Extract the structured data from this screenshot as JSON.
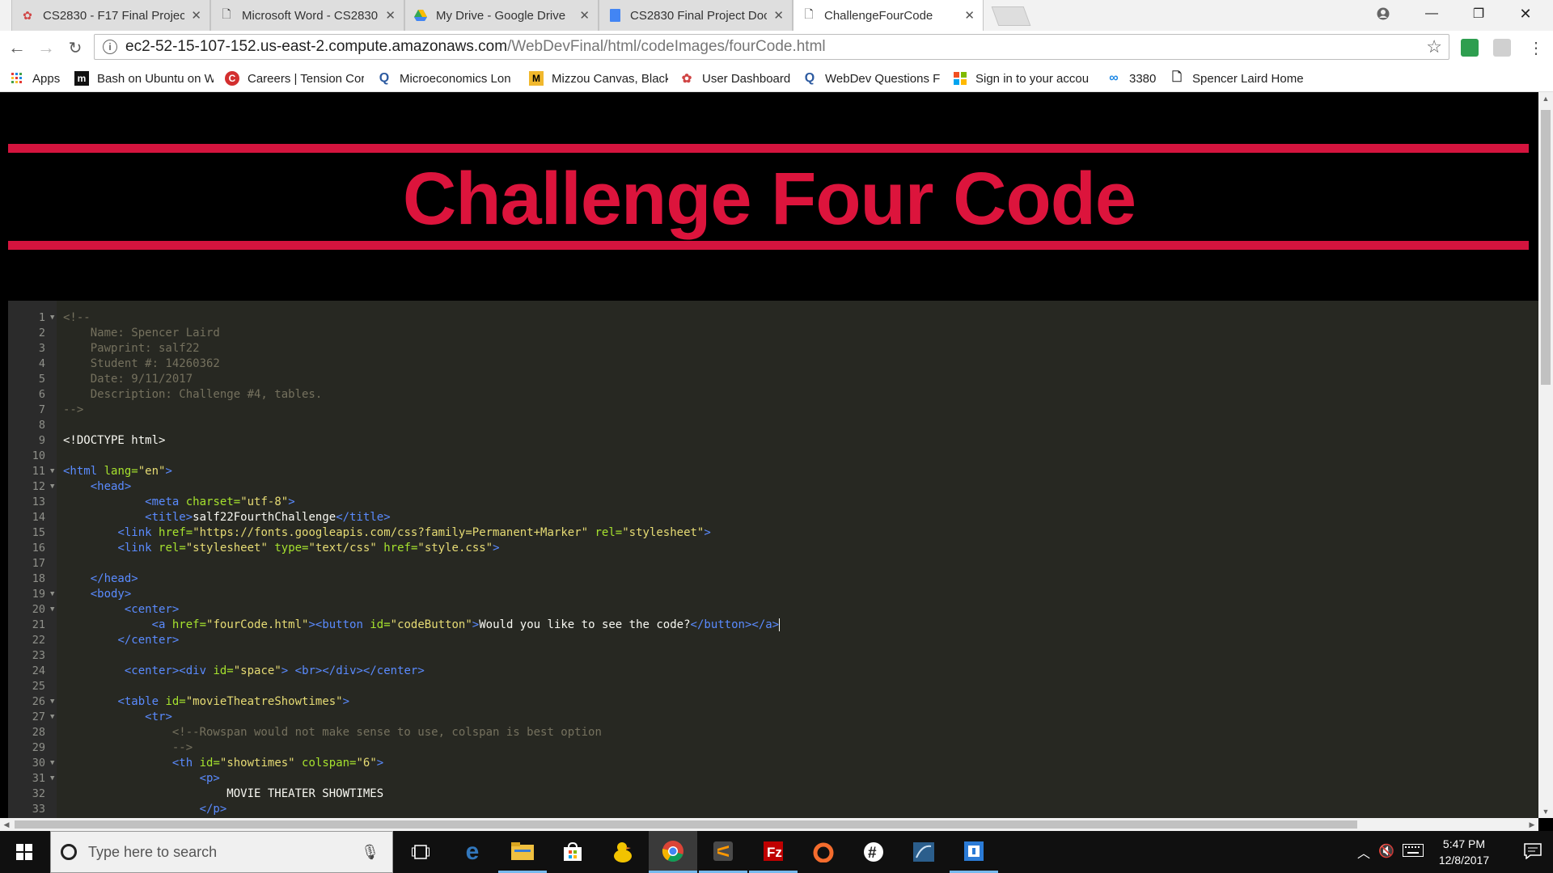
{
  "browser": {
    "tabs": [
      {
        "label": "CS2830 - F17 Final Projec",
        "icon": "gear-red-icon"
      },
      {
        "label": "Microsoft Word - CS2830",
        "icon": "page-icon"
      },
      {
        "label": "My Drive - Google Drive",
        "icon": "drive-icon"
      },
      {
        "label": "CS2830 Final Project Doc",
        "icon": "docs-icon"
      },
      {
        "label": "ChallengeFourCode",
        "icon": "page-icon",
        "active": true
      }
    ],
    "address": {
      "host": "ec2-52-15-107-152.us-east-2.compute.amazonaws.com",
      "path": "/WebDevFinal/html/codeImages/fourCode.html"
    },
    "bookmarks": [
      {
        "label": "Apps",
        "icon": "apps-grid-icon"
      },
      {
        "label": "Bash on Ubuntu on W",
        "icon": "m-logo-icon"
      },
      {
        "label": "Careers | Tension Cor",
        "icon": "careers-icon"
      },
      {
        "label": "Microeconomics Lon",
        "icon": "q-logo-icon"
      },
      {
        "label": "Mizzou Canvas, Black",
        "icon": "mizzou-icon"
      },
      {
        "label": "User Dashboard",
        "icon": "gear-red-icon"
      },
      {
        "label": "WebDev Questions F",
        "icon": "q-logo-icon"
      },
      {
        "label": "Sign in to your accou",
        "icon": "microsoft-icon"
      },
      {
        "label": "3380",
        "icon": "infinity-icon"
      },
      {
        "label": "Spencer Laird Home",
        "icon": "page-icon"
      }
    ]
  },
  "page": {
    "title": "Challenge Four Code",
    "colors": {
      "accent": "#dc143c",
      "background": "#000000"
    }
  },
  "code": {
    "lines": [
      {
        "n": "1",
        "fold": true,
        "html": "<span class='c-com'>&lt;!--</span>"
      },
      {
        "n": "2",
        "html": "<span class='c-com'>    Name: Spencer Laird</span>"
      },
      {
        "n": "3",
        "html": "<span class='c-com'>    Pawprint: salf22</span>"
      },
      {
        "n": "4",
        "html": "<span class='c-com'>    Student #: 14260362</span>"
      },
      {
        "n": "5",
        "html": "<span class='c-com'>    Date: 9/11/2017</span>"
      },
      {
        "n": "6",
        "html": "<span class='c-com'>    Description: Challenge #4, tables.</span>"
      },
      {
        "n": "7",
        "html": "<span class='c-com'>--&gt;</span>"
      },
      {
        "n": "8",
        "html": ""
      },
      {
        "n": "9",
        "html": "<span class='c-txt'>&lt;!DOCTYPE html&gt;</span>"
      },
      {
        "n": "10",
        "html": ""
      },
      {
        "n": "11",
        "fold": true,
        "html": "<span class='c-tag'>&lt;html</span> <span class='c-attr'>lang=</span><span class='c-str'>\"en\"</span><span class='c-tag'>&gt;</span>"
      },
      {
        "n": "12",
        "fold": true,
        "html": "    <span class='c-tag'>&lt;head&gt;</span>"
      },
      {
        "n": "13",
        "html": "            <span class='c-tag'>&lt;meta</span> <span class='c-attr'>charset=</span><span class='c-str'>\"utf-8\"</span><span class='c-tag'>&gt;</span>"
      },
      {
        "n": "14",
        "html": "            <span class='c-tag'>&lt;title&gt;</span><span class='c-txt'>salf22FourthChallenge</span><span class='c-tag'>&lt;/title&gt;</span>"
      },
      {
        "n": "15",
        "html": "        <span class='c-tag'>&lt;link</span> <span class='c-attr'>href=</span><span class='c-str'>\"https://fonts.googleapis.com/css?family=Permanent+Marker\"</span> <span class='c-attr'>rel=</span><span class='c-str'>\"stylesheet\"</span><span class='c-tag'>&gt;</span>"
      },
      {
        "n": "16",
        "html": "        <span class='c-tag'>&lt;link</span> <span class='c-attr'>rel=</span><span class='c-str'>\"stylesheet\"</span> <span class='c-attr'>type=</span><span class='c-str'>\"text/css\"</span> <span class='c-attr'>href=</span><span class='c-str'>\"style.css\"</span><span class='c-tag'>&gt;</span>"
      },
      {
        "n": "17",
        "html": ""
      },
      {
        "n": "18",
        "html": "    <span class='c-tag'>&lt;/head&gt;</span>"
      },
      {
        "n": "19",
        "fold": true,
        "html": "    <span class='c-tag'>&lt;body&gt;</span>"
      },
      {
        "n": "20",
        "fold": true,
        "html": "         <span class='c-tag'>&lt;center&gt;</span>"
      },
      {
        "n": "21",
        "html": "             <span class='c-tag'>&lt;a</span> <span class='c-attr'>href=</span><span class='c-str'>\"fourCode.html\"</span><span class='c-tag'>&gt;&lt;button</span> <span class='c-attr'>id=</span><span class='c-str'>\"codeButton\"</span><span class='c-tag'>&gt;</span><span class='c-txt'>Would you like to see the code?</span><span class='c-tag'>&lt;/button&gt;&lt;/a&gt;</span><span class='caret'></span>"
      },
      {
        "n": "22",
        "html": "        <span class='c-tag'>&lt;/center&gt;</span>"
      },
      {
        "n": "23",
        "html": ""
      },
      {
        "n": "24",
        "html": "         <span class='c-tag'>&lt;center&gt;&lt;div</span> <span class='c-attr'>id=</span><span class='c-str'>\"space\"</span><span class='c-tag'>&gt;</span> <span class='c-tag'>&lt;br&gt;&lt;/div&gt;&lt;/center&gt;</span>"
      },
      {
        "n": "25",
        "html": ""
      },
      {
        "n": "26",
        "fold": true,
        "html": "        <span class='c-tag'>&lt;table</span> <span class='c-attr'>id=</span><span class='c-str'>\"movieTheatreShowtimes\"</span><span class='c-tag'>&gt;</span>"
      },
      {
        "n": "27",
        "fold": true,
        "html": "            <span class='c-tag'>&lt;tr&gt;</span>"
      },
      {
        "n": "28",
        "html": "                <span class='c-com'>&lt;!--Rowspan would not make sense to use, colspan is best option</span>"
      },
      {
        "n": "29",
        "html": "                <span class='c-com'>--&gt;</span>"
      },
      {
        "n": "30",
        "fold": true,
        "html": "                <span class='c-tag'>&lt;th</span> <span class='c-attr'>id=</span><span class='c-str'>\"showtimes\"</span> <span class='c-attr'>colspan=</span><span class='c-str'>\"6\"</span><span class='c-tag'>&gt;</span>"
      },
      {
        "n": "31",
        "fold": true,
        "html": "                    <span class='c-tag'>&lt;p&gt;</span>"
      },
      {
        "n": "32",
        "html": "                        <span class='c-txt'>MOVIE THEATER SHOWTIMES</span>"
      },
      {
        "n": "33",
        "html": "                    <span class='c-tag'>&lt;/p&gt;</span>"
      }
    ]
  },
  "taskbar": {
    "search_placeholder": "Type here to search",
    "time": "5:47 PM",
    "date": "12/8/2017"
  }
}
